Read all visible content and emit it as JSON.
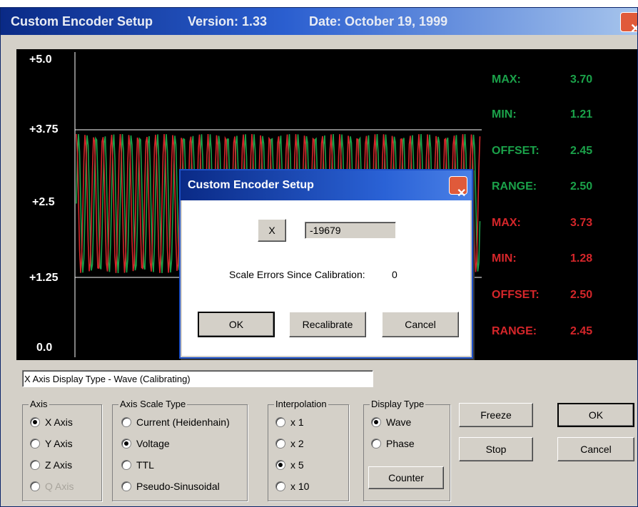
{
  "window": {
    "title": "Custom Encoder Setup",
    "version": "Version: 1.33",
    "date": "Date: October 19, 1999",
    "close_glyph": "✕"
  },
  "plot": {
    "y_labels": [
      "+5.0",
      "+3.75",
      "+2.5",
      "+1.25",
      "0.0"
    ],
    "stats": [
      {
        "label": "MAX:",
        "value": "3.70",
        "color": "#1ba24a"
      },
      {
        "label": "MIN:",
        "value": "1.21",
        "color": "#1ba24a"
      },
      {
        "label": "OFFSET:",
        "value": "2.45",
        "color": "#1ba24a"
      },
      {
        "label": "RANGE:",
        "value": "2.50",
        "color": "#1ba24a"
      },
      {
        "label": "MAX:",
        "value": "3.73",
        "color": "#d5262a"
      },
      {
        "label": "MIN:",
        "value": "1.28",
        "color": "#d5262a"
      },
      {
        "label": "OFFSET:",
        "value": "2.50",
        "color": "#d5262a"
      },
      {
        "label": "RANGE:",
        "value": "2.45",
        "color": "#d5262a"
      }
    ]
  },
  "dialog": {
    "title": "Custom Encoder Setup",
    "axis_button": "X",
    "count_value": "-19679",
    "scale_errors_label": "Scale Errors Since Calibration:",
    "scale_errors_value": "0",
    "ok": "OK",
    "recalibrate": "Recalibrate",
    "cancel": "Cancel"
  },
  "status_text": "X Axis   Display Type - Wave (Calibrating)",
  "axis_group": {
    "label": "Axis",
    "options": [
      {
        "label": "X Axis",
        "selected": true,
        "disabled": false
      },
      {
        "label": "Y Axis",
        "selected": false,
        "disabled": false
      },
      {
        "label": "Z Axis",
        "selected": false,
        "disabled": false
      },
      {
        "label": "Q Axis",
        "selected": false,
        "disabled": true
      }
    ]
  },
  "scale_group": {
    "label": "Axis Scale Type",
    "options": [
      {
        "label": "Current (Heidenhain)",
        "selected": false
      },
      {
        "label": "Voltage",
        "selected": true
      },
      {
        "label": "TTL",
        "selected": false
      },
      {
        "label": "Pseudo-Sinusoidal",
        "selected": false
      }
    ]
  },
  "interp_group": {
    "label": "Interpolation",
    "options": [
      {
        "label": "x 1",
        "selected": false
      },
      {
        "label": "x 2",
        "selected": false
      },
      {
        "label": "x 5",
        "selected": true
      },
      {
        "label": "x 10",
        "selected": false
      }
    ]
  },
  "display_group": {
    "label": "Display Type",
    "options": [
      {
        "label": "Wave",
        "selected": true
      },
      {
        "label": "Phase",
        "selected": false
      }
    ],
    "counter_button": "Counter"
  },
  "buttons": {
    "freeze": "Freeze",
    "stop": "Stop",
    "ok": "OK",
    "cancel": "Cancel"
  }
}
